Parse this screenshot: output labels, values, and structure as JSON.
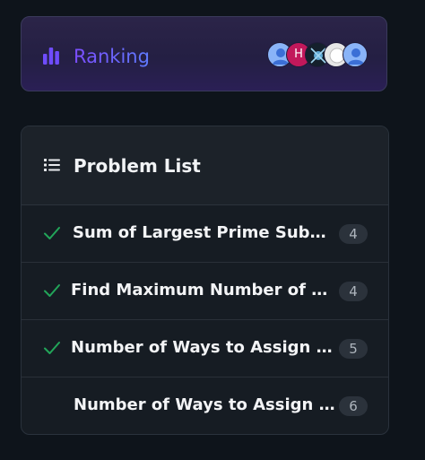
{
  "ranking": {
    "label": "Ranking",
    "accent_color": "#7c4dff",
    "avatars": [
      {
        "type": "user-icon",
        "color": "#8ab4f8"
      },
      {
        "type": "initial",
        "text": "H",
        "color": "#c2185b"
      },
      {
        "type": "image",
        "color": "#1a2a3a"
      },
      {
        "type": "image",
        "color": "#e0e0e0"
      },
      {
        "type": "user-icon",
        "color": "#8ab4f8"
      }
    ]
  },
  "problem_list": {
    "title": "Problem List",
    "check_color": "#22a559",
    "items": [
      {
        "title": "Sum of Largest Prime Substri...",
        "count": "4",
        "solved": true
      },
      {
        "title": "Find Maximum Number of No...",
        "count": "4",
        "solved": true
      },
      {
        "title": "Number of Ways to Assign Ed...",
        "count": "5",
        "solved": true
      },
      {
        "title": "Number of Ways to Assign Ed...",
        "count": "6",
        "solved": false
      }
    ]
  }
}
